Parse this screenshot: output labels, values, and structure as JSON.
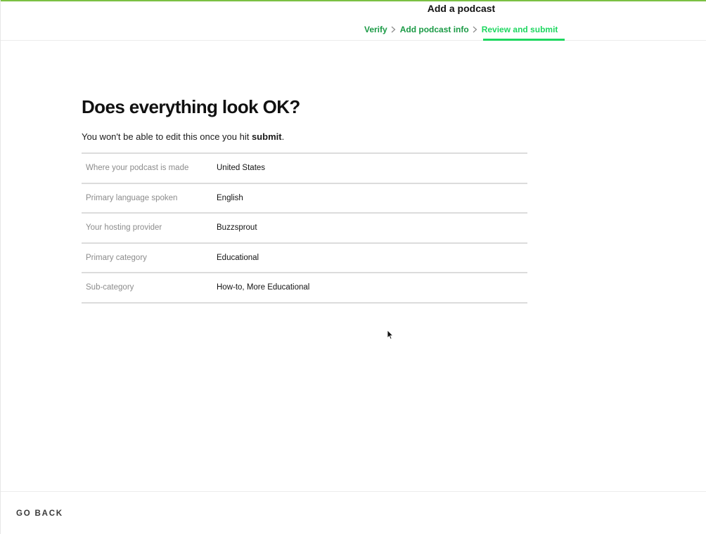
{
  "header": {
    "title": "Add a podcast",
    "steps": [
      {
        "label": "Verify",
        "state": "complete"
      },
      {
        "label": "Add podcast info",
        "state": "complete"
      },
      {
        "label": "Review and submit",
        "state": "active"
      }
    ]
  },
  "main": {
    "heading": "Does everything look OK?",
    "subtext_before": "You won't be able to edit this once you hit ",
    "subtext_bold": "submit",
    "subtext_after": ".",
    "rows": [
      {
        "label": "Where your podcast is made",
        "value": "United States"
      },
      {
        "label": "Primary language spoken",
        "value": "English"
      },
      {
        "label": "Your hosting provider",
        "value": "Buzzsprout"
      },
      {
        "label": "Primary category",
        "value": "Educational"
      },
      {
        "label": "Sub-category",
        "value": "How-to, More Educational"
      }
    ]
  },
  "footer": {
    "back_label": "GO BACK"
  },
  "colors": {
    "accent": "#1ed760",
    "step_complete": "#1a9a45",
    "top_bar": "#7bc043",
    "divider": "#dcdcdc",
    "label_gray": "#8c8c8c"
  },
  "icons": {
    "step_separator": "chevron-right-icon",
    "pointer": "mouse-cursor-icon"
  }
}
